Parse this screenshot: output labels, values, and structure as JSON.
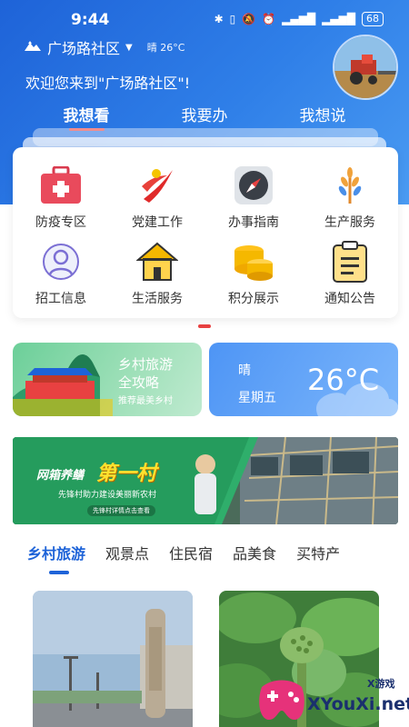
{
  "status_bar": {
    "time": "9:44",
    "icons": [
      "bluetooth-icon",
      "vibrate-icon",
      "mute-icon",
      "alarm-icon",
      "hd-icon",
      "signal-4g-icon",
      "hd-icon",
      "signal-4g-icon"
    ],
    "battery": "68"
  },
  "header": {
    "location": "广场路社区",
    "weather_mini": "晴 26°C",
    "welcome": "欢迎您来到\"广场路社区\"!",
    "tabs": [
      {
        "label": "我想看",
        "active": true
      },
      {
        "label": "我要办",
        "active": false
      },
      {
        "label": "我想说",
        "active": false
      }
    ]
  },
  "services": [
    {
      "label": "防疫专区",
      "icon": "first-aid-kit-icon"
    },
    {
      "label": "党建工作",
      "icon": "party-emblem-icon"
    },
    {
      "label": "办事指南",
      "icon": "compass-icon"
    },
    {
      "label": "生产服务",
      "icon": "wheat-icon"
    },
    {
      "label": "招工信息",
      "icon": "worker-icon"
    },
    {
      "label": "生活服务",
      "icon": "house-icon"
    },
    {
      "label": "积分展示",
      "icon": "coins-icon"
    },
    {
      "label": "通知公告",
      "icon": "clipboard-icon"
    }
  ],
  "promo": {
    "title_line1": "乡村旅游",
    "title_line2": "全攻略",
    "subtitle": "推荐最美乡村"
  },
  "weather": {
    "condition": "晴",
    "day": "星期五",
    "temperature": "26°C"
  },
  "banner": {
    "prefix": "网箱养鳝",
    "headline": "第一村",
    "tagline": "先锋村助力建设美丽新农村",
    "cta": "先锋村详情点击查看"
  },
  "content_tabs": [
    {
      "label": "乡村旅游",
      "active": true
    },
    {
      "label": "观景点",
      "active": false
    },
    {
      "label": "住民宿",
      "active": false
    },
    {
      "label": "品美食",
      "active": false
    },
    {
      "label": "买特产",
      "active": false
    }
  ],
  "watermark": {
    "brand": "XYouXi.net",
    "small": "X游戏"
  },
  "colors": {
    "primary": "#1e63d8",
    "accent_red": "#e84141"
  }
}
